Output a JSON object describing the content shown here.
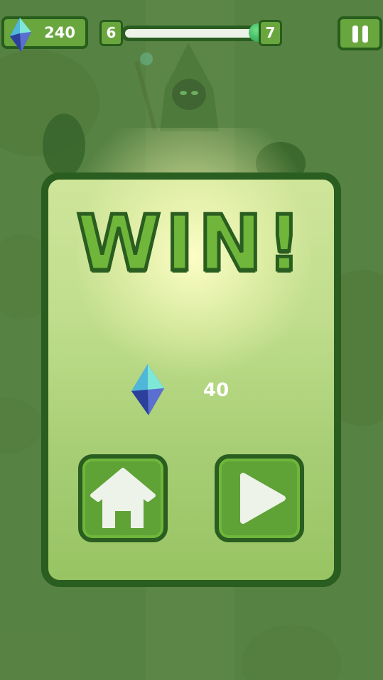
{
  "hud": {
    "gems": "240",
    "level_current": "6",
    "level_next": "7",
    "progress": 1.0
  },
  "dialog": {
    "title": "WIN!",
    "reward_amount": "40"
  },
  "colors": {
    "dark_green": "#2a5d20",
    "button_green": "#5fa236",
    "panel_light": "#cfe59a",
    "title_green": "#6fb63b"
  },
  "icons": {
    "gem": "crystal-gem-icon",
    "pause": "pause-icon",
    "home": "home-icon",
    "play": "play-icon"
  }
}
